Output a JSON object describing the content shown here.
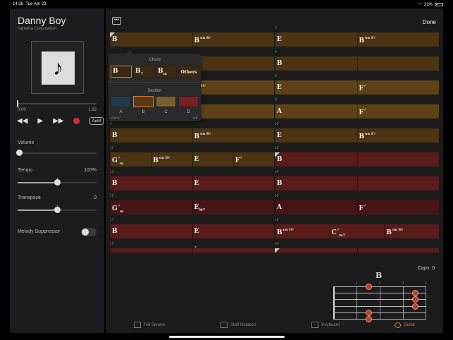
{
  "status": {
    "time": "14:26",
    "date": "Tue Apr 23",
    "battery": "22%"
  },
  "player": {
    "title": "Danny Boy",
    "subtitle": "Yamaha Corporation",
    "time_start": "0:00",
    "time_end": "1:22",
    "ab_label": "A⇄B",
    "volume_label": "Volume",
    "tempo_label": "Tempo",
    "tempo_value": "100%",
    "transpose_label": "Transpose",
    "transpose_value": "0",
    "melody_label": "Melody Suppressor"
  },
  "toolbar": {
    "more_label": "•••",
    "done_label": "Done"
  },
  "measures": [
    {
      "left_num": "",
      "right_num": "2",
      "left": [
        "B",
        "B|on D♯"
      ],
      "right": [
        "E",
        "B|on F♯"
      ],
      "lsec": "a",
      "rsec": "a",
      "lmark": true,
      "rmark": false
    },
    {
      "left_num": "",
      "right_num": "4",
      "left": [
        "",
        "F|♯"
      ],
      "right": [
        "B",
        ""
      ],
      "lsec": "a",
      "rsec": "a",
      "lmark": false,
      "rmark": false
    },
    {
      "left_num": "",
      "right_num": "6",
      "left": [
        "",
        "on D♯"
      ],
      "right": [
        "E",
        "F|♯"
      ],
      "lsec": "b",
      "rsec": "b",
      "lmark": false,
      "rmark": false
    },
    {
      "left_num": "",
      "right_num": "8",
      "left": [
        "",
        "F|♯"
      ],
      "right": [
        "A",
        "F|♯"
      ],
      "lsec": "b",
      "rsec": "b",
      "lmark": false,
      "rmark": false
    },
    {
      "left_num": "9",
      "right_num": "10",
      "left": [
        "B",
        "B|on D♯"
      ],
      "right": [
        "E",
        "B|on F♯"
      ],
      "lsec": "a",
      "rsec": "a",
      "lmark": false,
      "rmark": false
    },
    {
      "left_num": "11",
      "right_num": "12",
      "left": [
        "G|♯m",
        "B|on D♯",
        "E",
        "F|♯"
      ],
      "right": [
        "B",
        ""
      ],
      "lsec": "a",
      "rsec": "c",
      "lmark": false,
      "rmark": true
    },
    {
      "left_num": "13",
      "right_num": "14",
      "left": [
        "B",
        "E"
      ],
      "right": [
        "B",
        ""
      ],
      "lsec": "c",
      "rsec": "c",
      "lmark": false,
      "rmark": false
    },
    {
      "left_num": "15",
      "right_num": "16",
      "left": [
        "G|♯m",
        "E|M7"
      ],
      "right": [
        "A",
        "F|♯"
      ],
      "lsec": "d",
      "rsec": "d",
      "lmark": false,
      "rmark": false
    },
    {
      "left_num": "17",
      "right_num": "18",
      "left": [
        "B",
        "E"
      ],
      "right": [
        "B|on D♯",
        "C|♯m7",
        "B|on D♯"
      ],
      "lsec": "c",
      "rsec": "c",
      "lmark": false,
      "rmark": false
    },
    {
      "left_num": "19",
      "right_num": "20",
      "left": [
        "",
        "♯"
      ],
      "right": [
        "",
        ""
      ],
      "lsec": "c",
      "rsec": "c",
      "lmark": false,
      "rmark": true
    }
  ],
  "popup": {
    "chord_header": "Chord",
    "section_header": "Section",
    "chips": [
      "B",
      "B7",
      "Bm",
      "Others"
    ],
    "sections": [
      {
        "label": "A",
        "color": "#1f3b4d"
      },
      {
        "label": "B",
        "color": "#5a3a12"
      },
      {
        "label": "C",
        "color": "#7a5f2e"
      },
      {
        "label": "D",
        "color": "#7a1e22"
      }
    ],
    "peek_left": "A,B m7",
    "peek_right": "A,B"
  },
  "guitar": {
    "chord_name": "B",
    "capo": "Capo: 0",
    "fret_numbers": [
      "1",
      "2",
      "3",
      "4"
    ]
  },
  "tabs": [
    {
      "label": "Full Screen",
      "icon": "fullscreen-icon",
      "active": false
    },
    {
      "label": "Staff Notation",
      "icon": "staff-notation-icon",
      "active": false
    },
    {
      "label": "Keyboard",
      "icon": "keyboard-icon",
      "active": false
    },
    {
      "label": "Guitar",
      "icon": "guitar-icon",
      "active": true
    }
  ]
}
